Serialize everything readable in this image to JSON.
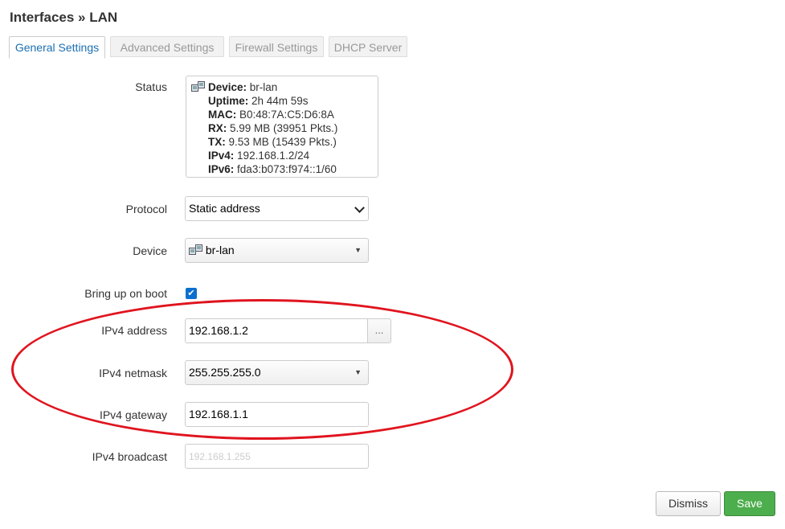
{
  "page": {
    "title": "Interfaces » LAN"
  },
  "tabs": [
    {
      "label": "General Settings",
      "active": true
    },
    {
      "label": "Advanced Settings",
      "active": false
    },
    {
      "label": "Firewall Settings",
      "active": false
    },
    {
      "label": "DHCP Server",
      "active": false
    }
  ],
  "status": {
    "label": "Status",
    "icon": "network-device-icon",
    "lines": [
      {
        "key": "Device:",
        "value": "br-lan"
      },
      {
        "key": "Uptime:",
        "value": "2h 44m 59s"
      },
      {
        "key": "MAC:",
        "value": "B0:48:7A:C5:D6:8A"
      },
      {
        "key": "RX:",
        "value": "5.99 MB (39951 Pkts.)"
      },
      {
        "key": "TX:",
        "value": "9.53 MB (15439 Pkts.)"
      },
      {
        "key": "IPv4:",
        "value": "192.168.1.2/24"
      },
      {
        "key": "IPv6:",
        "value": "fda3:b073:f974::1/60"
      }
    ]
  },
  "fields": {
    "protocol": {
      "label": "Protocol",
      "value": "Static address"
    },
    "device": {
      "label": "Device",
      "value": "br-lan"
    },
    "boot": {
      "label": "Bring up on boot",
      "checked": true
    },
    "ipv4_address": {
      "label": "IPv4 address",
      "value": "192.168.1.2",
      "button": "..."
    },
    "ipv4_netmask": {
      "label": "IPv4 netmask",
      "value": "255.255.255.0"
    },
    "ipv4_gateway": {
      "label": "IPv4 gateway",
      "value": "192.168.1.1"
    },
    "ipv4_broadcast": {
      "label": "IPv4 broadcast",
      "placeholder": "192.168.1.255"
    }
  },
  "actions": {
    "dismiss": "Dismiss",
    "save": "Save"
  },
  "annotation": {
    "shape": "ellipse",
    "color": "#e0141e"
  },
  "colors": {
    "save": "#4cae4c",
    "active_tab": "#1a6fb3",
    "checkbox": "#0b6fd0"
  }
}
